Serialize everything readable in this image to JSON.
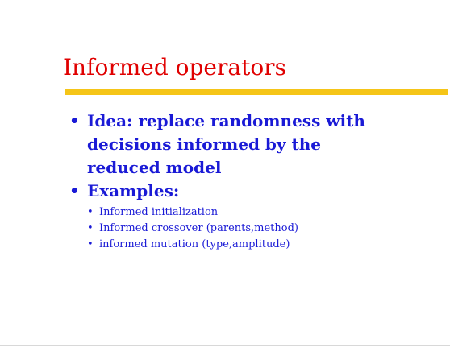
{
  "colors": {
    "background": "#ffffff",
    "title": "#e00000",
    "body_text": "#1a1ad6",
    "accent_rule": "#f5c518"
  },
  "slide": {
    "title": "Informed operators",
    "bullet_marker": "•",
    "bullets": [
      {
        "text": "Idea: replace randomness with decisions informed by the reduced model"
      },
      {
        "text": "Examples:",
        "sub_bullets": [
          {
            "text": "Informed initialization"
          },
          {
            "text": "Informed crossover (parents,method)"
          },
          {
            "text": "informed mutation (type,amplitude)"
          }
        ]
      }
    ]
  }
}
